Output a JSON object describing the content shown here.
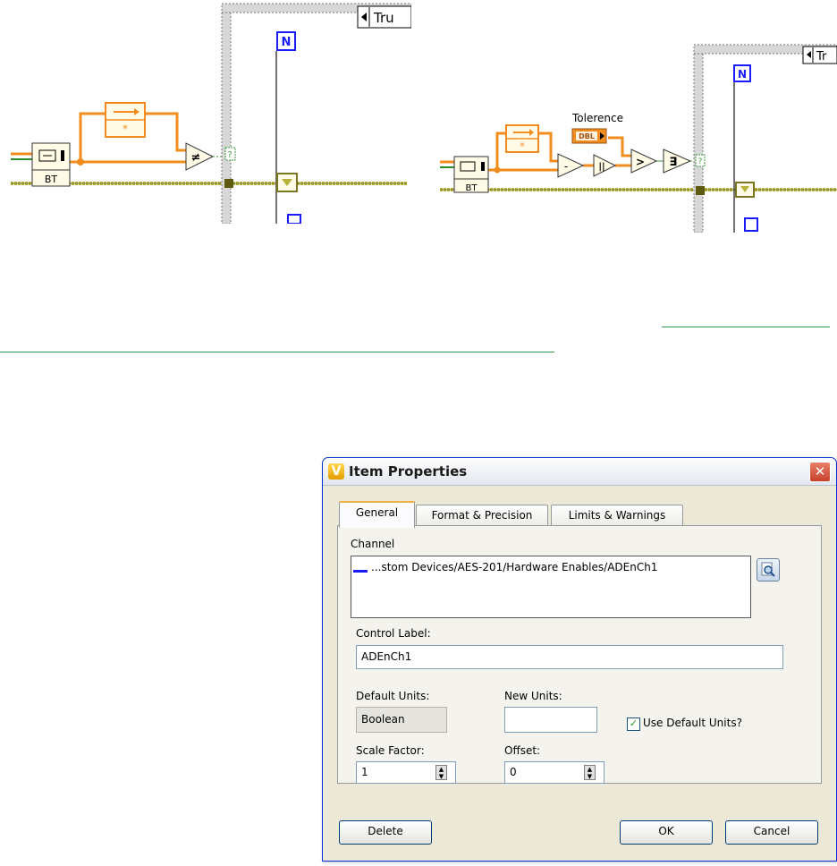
{
  "diagram_left": {
    "bt_label": "BT",
    "case_label": "Tru",
    "n_label": "N",
    "not_equal_symbol": "≠",
    "terminal_symbol": "?"
  },
  "diagram_right": {
    "bt_label": "BT",
    "case_label": "Tr",
    "n_label": "N",
    "tolerance_label": "Tolerence",
    "dbl_label": "DBL",
    "subtract_symbol": "-",
    "abs_symbol": "||",
    "greater_symbol": ">",
    "or_symbol": "∃",
    "terminal_symbol": "?"
  },
  "dialog": {
    "title": "Item Properties",
    "close_symbol": "✕",
    "logo_letter": "V",
    "tabs": [
      {
        "label": "General",
        "active": true
      },
      {
        "label": "Format & Precision",
        "active": false
      },
      {
        "label": "Limits & Warnings",
        "active": false
      }
    ],
    "channel_label": "Channel",
    "channel_value": "...stom Devices/AES-201/Hardware Enables/ADEnCh1",
    "control_label_label": "Control Label:",
    "control_label_value": "ADEnCh1",
    "default_units_label": "Default Units:",
    "default_units_value": "Boolean",
    "new_units_label": "New Units:",
    "new_units_value": "",
    "use_default_label": "Use Default Units?",
    "use_default_checked": true,
    "scale_factor_label": "Scale Factor:",
    "scale_factor_value": "1",
    "offset_label": "Offset:",
    "offset_value": "0",
    "buttons": {
      "delete": "Delete",
      "ok": "OK",
      "cancel": "Cancel"
    }
  },
  "colors": {
    "orange_wire": "#f28c1f",
    "bool_wire": "#b7b23b",
    "separator": "#2f9a4f",
    "n_blue": "#1a1aff",
    "xp_blue": "#0831d9"
  }
}
